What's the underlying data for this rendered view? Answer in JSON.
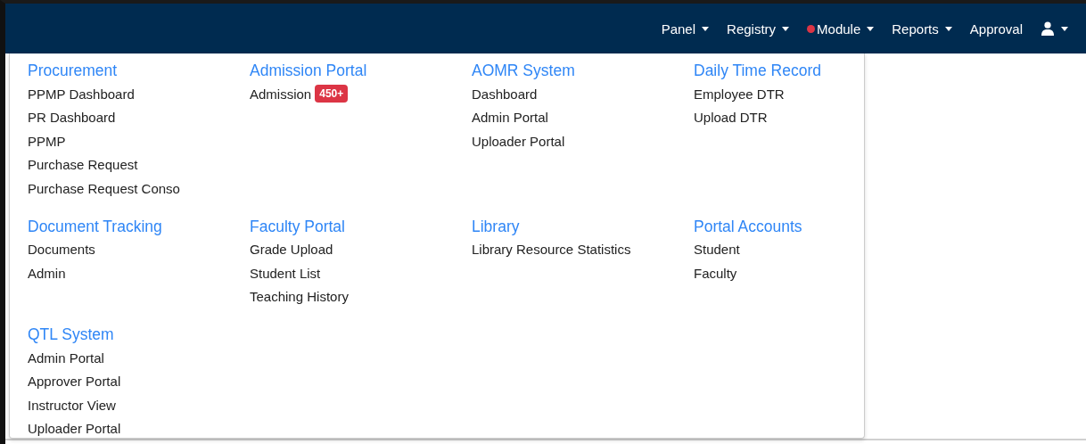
{
  "navbar": {
    "items": [
      {
        "label": "Panel",
        "caret": true,
        "alert": false
      },
      {
        "label": "Registry",
        "caret": true,
        "alert": false
      },
      {
        "label": "Module",
        "caret": true,
        "alert": true
      },
      {
        "label": "Reports",
        "caret": true,
        "alert": false
      },
      {
        "label": "Approval",
        "caret": false,
        "alert": false
      }
    ],
    "user_menu": {
      "caret": true
    }
  },
  "dropdown": {
    "sections": [
      {
        "title": "Procurement",
        "items": [
          {
            "label": "PPMP Dashboard"
          },
          {
            "label": "PR Dashboard"
          },
          {
            "label": "PPMP"
          },
          {
            "label": "Purchase Request"
          },
          {
            "label": "Purchase Request Conso"
          }
        ]
      },
      {
        "title": "Admission Portal",
        "items": [
          {
            "label": "Admission",
            "badge": "450+"
          }
        ]
      },
      {
        "title": "AOMR System",
        "items": [
          {
            "label": "Dashboard"
          },
          {
            "label": "Admin Portal"
          },
          {
            "label": "Uploader Portal"
          }
        ]
      },
      {
        "title": "Daily Time Record",
        "items": [
          {
            "label": "Employee DTR"
          },
          {
            "label": "Upload DTR"
          }
        ]
      },
      {
        "title": "Document Tracking",
        "items": [
          {
            "label": "Documents"
          },
          {
            "label": "Admin"
          }
        ]
      },
      {
        "title": "Faculty Portal",
        "items": [
          {
            "label": "Grade Upload"
          },
          {
            "label": "Student List"
          },
          {
            "label": "Teaching History"
          }
        ]
      },
      {
        "title": "Library",
        "items": [
          {
            "label": "Library Resource Statistics"
          }
        ]
      },
      {
        "title": "Portal Accounts",
        "items": [
          {
            "label": "Student"
          },
          {
            "label": "Faculty"
          }
        ]
      },
      {
        "title": "QTL System",
        "items": [
          {
            "label": "Admin Portal"
          },
          {
            "label": "Approver Portal"
          },
          {
            "label": "Instructor View"
          },
          {
            "label": "Uploader Portal"
          }
        ]
      }
    ]
  }
}
